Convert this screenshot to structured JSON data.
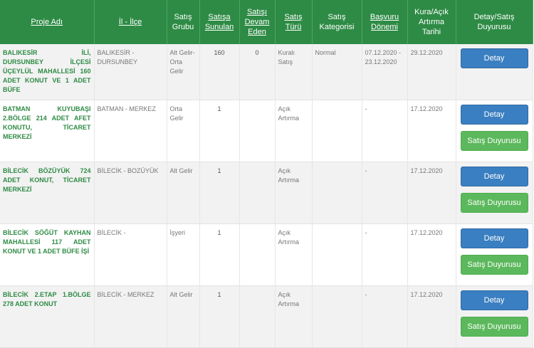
{
  "header": {
    "proje_adi": "Proje Adı",
    "il_ilce": "İl - İlçe",
    "satis_grubu": "Satış Grubu",
    "satisa_sunulan": "Satışa Sunulan",
    "satisi_devam_eden": "Satışı Devam Eden",
    "satis_turu": "Satış Türü",
    "satis_kategorisi": "Satış Kategorisi",
    "basvuru_donemi": "Başvuru Dönemi",
    "kura_tarihi": "Kura/Açık Artırma Tarihi",
    "detay_satis": "Detay/Satış Duyurusu"
  },
  "buttons": {
    "detay": "Detay",
    "satis_duyurusu": "Satış Duyurusu"
  },
  "rows": [
    {
      "proje": "BALIKESİR İLİ, DURSUNBEY İLÇESİ ÜÇEYLÜL MAHALLESİ 160 ADET KONUT VE 1 ADET BÜFE",
      "il_ilce": "BALIKESİR - DURSUNBEY",
      "grup": "Alt Gelir-Orta Gelir",
      "sunulan": "160",
      "devam": "0",
      "tur": "Kuralı Satış",
      "kategori": "Normal",
      "basvuru": "07.12.2020 - 23.12.2020",
      "tarih": "29.12.2020"
    },
    {
      "proje": "BATMAN KUYUBAŞI 2.BÖLGE 214 ADET AFET KONUTU, TİCARET MERKEZİ",
      "il_ilce": "BATMAN - MERKEZ",
      "grup": "Orta Gelir",
      "sunulan": "1",
      "devam": "",
      "tur": "Açık Artırma",
      "kategori": "",
      "basvuru": "-",
      "tarih": "17.12.2020"
    },
    {
      "proje": "BİLECİK BÖZÜYÜK 724 ADET KONUT, TİCARET MERKEZİ",
      "il_ilce": "BİLECİK - BOZÜYÜK",
      "grup": "Alt Gelir",
      "sunulan": "1",
      "devam": "",
      "tur": "Açık Artırma",
      "kategori": "",
      "basvuru": "-",
      "tarih": "17.12.2020"
    },
    {
      "proje": "BİLECİK SÖĞÜT KAYHAN MAHALLESİ 117 ADET KONUT VE 1 ADET BÜFE İŞİ",
      "il_ilce": "BİLECİK -",
      "grup": "İşyeri",
      "sunulan": "1",
      "devam": "",
      "tur": "Açık Artırma",
      "kategori": "",
      "basvuru": "-",
      "tarih": "17.12.2020"
    },
    {
      "proje": "BİLECİK 2.ETAP 1.BÖLGE 278 ADET KONUT",
      "il_ilce": "BİLECİK - MERKEZ",
      "grup": "Alt Gelir",
      "sunulan": "1",
      "devam": "",
      "tur": "Açık Artırma",
      "kategori": "",
      "basvuru": "-",
      "tarih": "17.12.2020"
    }
  ]
}
